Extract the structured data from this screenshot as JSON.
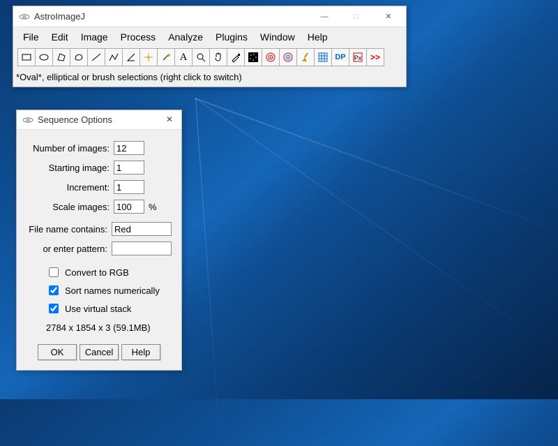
{
  "main": {
    "title": "AstroImageJ",
    "menus": [
      "File",
      "Edit",
      "Image",
      "Process",
      "Analyze",
      "Plugins",
      "Window",
      "Help"
    ],
    "status": "*Oval*, elliptical or brush selections (right click to switch)",
    "tools": [
      "rect-select",
      "oval-select",
      "polygon-select",
      "freehand-select",
      "line-tool",
      "segmented-line",
      "angle-tool",
      "point-tool",
      "wand-tool",
      "text-tool",
      "magnifier",
      "hand-tool",
      "color-picker",
      "lut-tool",
      "annulus-red",
      "annulus-blue",
      "clear-tool",
      "astrometry-grid",
      "dp-tool",
      "px-tool",
      "more-tools"
    ]
  },
  "dialog": {
    "title": "Sequence Options",
    "fields": {
      "num_images_label": "Number of images:",
      "num_images_value": "12",
      "starting_image_label": "Starting image:",
      "starting_image_value": "1",
      "increment_label": "Increment:",
      "increment_value": "1",
      "scale_label": "Scale images:",
      "scale_value": "100",
      "scale_unit": "%",
      "contains_label": "File name contains:",
      "contains_value": "Red",
      "pattern_label": "or enter pattern:",
      "pattern_value": ""
    },
    "checks": {
      "rgb_label": "Convert to RGB",
      "rgb_checked": false,
      "sort_label": "Sort names numerically",
      "sort_checked": true,
      "virtual_label": "Use virtual stack",
      "virtual_checked": true
    },
    "meminfo": "2784 x 1854 x 3 (59.1MB)",
    "buttons": {
      "ok": "OK",
      "cancel": "Cancel",
      "help": "Help"
    }
  }
}
